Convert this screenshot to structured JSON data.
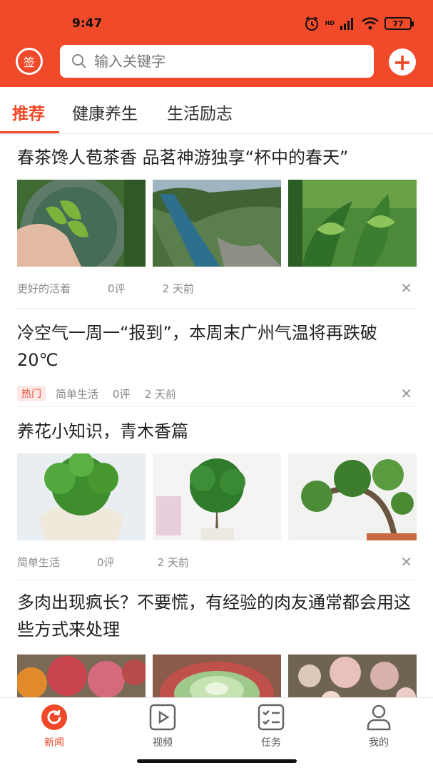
{
  "status_bar": {
    "time": "9:47",
    "hd_label": "HD",
    "battery": "77"
  },
  "header": {
    "sign_label": "签",
    "search_placeholder": "输入关键字",
    "add_label": "+"
  },
  "tabs": [
    {
      "label": "推荐",
      "active": true
    },
    {
      "label": "健康养生",
      "active": false
    },
    {
      "label": "生活励志",
      "active": false
    }
  ],
  "articles": [
    {
      "title": "春茶馋人苞茶香 品茗神游独享“杯中的春天”",
      "source": "更好的活着",
      "comments": "0评",
      "time": "2 天前",
      "images": [
        "tea-leaves-in-hand",
        "river-valley",
        "tea-plant"
      ]
    },
    {
      "title": "冷空气一周一“报到”，本周末广州气温将再跌破20℃",
      "badge": "热门",
      "source": "简单生活",
      "comments": "0评",
      "time": "2 天前"
    },
    {
      "title": "养花小知识，青木香篇",
      "source": "简单生活",
      "comments": "0评",
      "time": "2 天前",
      "images": [
        "potted-shrub",
        "bonsai-tree",
        "bonsai-branch"
      ]
    },
    {
      "title": "多肉出现疯长？不要慌，有经验的肉友通常都会用这些方式来处理",
      "images": [
        "succulents-red",
        "succulent-rosette",
        "succulents-pink"
      ]
    }
  ],
  "close_symbol": "✕",
  "bottom_nav": [
    {
      "label": "新闻",
      "icon": "refresh-icon",
      "active": true
    },
    {
      "label": "视频",
      "icon": "video-icon",
      "active": false
    },
    {
      "label": "任务",
      "icon": "task-list-icon",
      "active": false
    },
    {
      "label": "我的",
      "icon": "profile-icon",
      "active": false
    }
  ],
  "colors": {
    "accent": "#f04a2a",
    "text": "#222222",
    "meta": "#8a8a8a"
  }
}
